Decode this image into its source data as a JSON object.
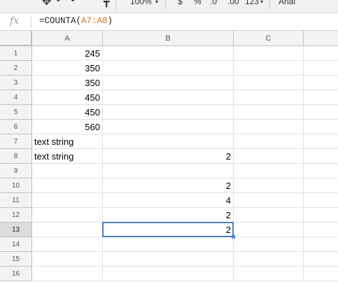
{
  "toolbar": {
    "zoom": "100%",
    "currency": "$",
    "percent": "%",
    "dec_dec": ".0",
    "dec_inc": ".00",
    "more_formats": "123",
    "font": "Arial"
  },
  "formula_bar": {
    "fx_label": "fx",
    "prefix": "=COUNTA(",
    "range": "A7:A8",
    "suffix": ")"
  },
  "columns": [
    "A",
    "B",
    "C"
  ],
  "rows": [
    {
      "num": "1",
      "a": "245",
      "b": ""
    },
    {
      "num": "2",
      "a": "350",
      "b": ""
    },
    {
      "num": "3",
      "a": "350",
      "b": ""
    },
    {
      "num": "4",
      "a": "450",
      "b": ""
    },
    {
      "num": "5",
      "a": "450",
      "b": ""
    },
    {
      "num": "6",
      "a": "560",
      "b": ""
    },
    {
      "num": "7",
      "a": "text string",
      "b": ""
    },
    {
      "num": "8",
      "a": "text string",
      "b": "2"
    },
    {
      "num": "9",
      "a": "",
      "b": ""
    },
    {
      "num": "10",
      "a": "",
      "b": "2"
    },
    {
      "num": "11",
      "a": "",
      "b": "4"
    },
    {
      "num": "12",
      "a": "",
      "b": "2"
    },
    {
      "num": "13",
      "a": "",
      "b": "2"
    },
    {
      "num": "14",
      "a": "",
      "b": ""
    },
    {
      "num": "15",
      "a": "",
      "b": ""
    },
    {
      "num": "16",
      "a": "",
      "b": ""
    }
  ],
  "selection": {
    "row": "13",
    "column": "B"
  }
}
